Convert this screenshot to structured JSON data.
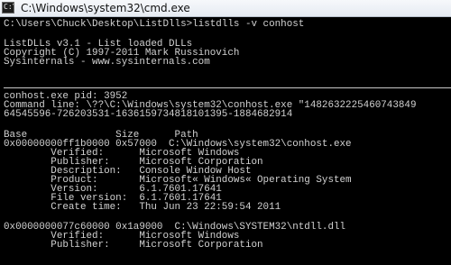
{
  "window": {
    "title": "C:\\Windows\\system32\\cmd.exe",
    "icon": "cmd-icon"
  },
  "console": {
    "lines": [
      "C:\\Users\\Chuck\\Desktop\\ListDlls>listdlls -v conhost",
      "",
      "ListDLLs v3.1 - List loaded DLLs",
      "Copyright (C) 1997-2011 Mark Russinovich",
      "Sysinternals - www.sysinternals.com",
      "",
      "conhost.exe pid: 3952",
      "Command line: \\??\\C:\\Windows\\system32\\conhost.exe \"1482632225460743849",
      "64545596-726203531-1636159734818101395-1884682914",
      "",
      "Base               Size      Path",
      "0x00000000ff1b0000 0x57000  C:\\Windows\\system32\\conhost.exe",
      "        Verified:      Microsoft Windows",
      "        Publisher:     Microsoft Corporation",
      "        Description:   Console Window Host",
      "        Product:       Microsoft« Windows« Operating System",
      "        Version:       6.1.7601.17641",
      "        File version:  6.1.7601.17641",
      "        Create time:   Thu Jun 23 22:59:54 2011",
      "",
      "0x0000000077c60000 0x1a9000  C:\\Windows\\SYSTEM32\\ntdll.dll",
      "        Verified:      Microsoft Windows",
      "        Publisher:     Microsoft Corporation"
    ]
  }
}
